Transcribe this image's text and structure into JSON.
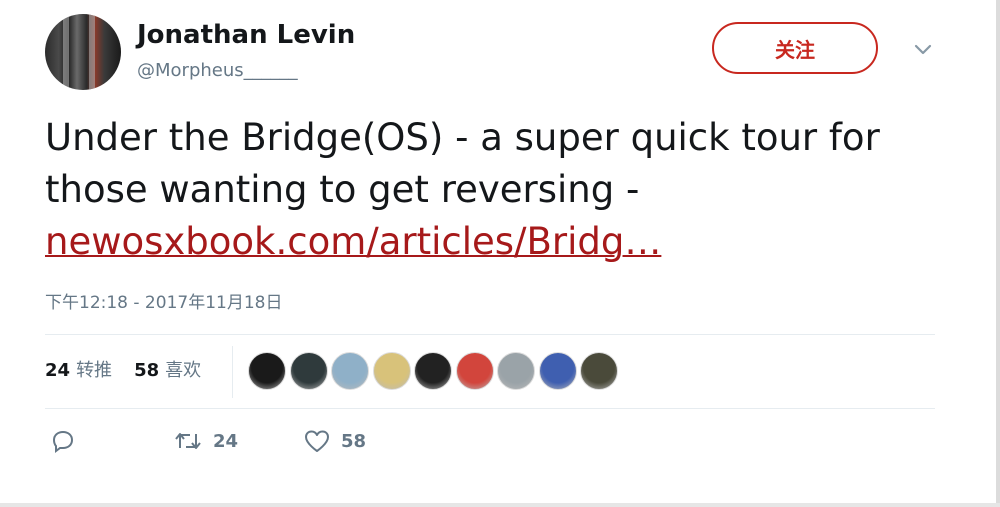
{
  "author": {
    "name": "Jonathan Levin",
    "handle": "@Morpheus______"
  },
  "follow_button": {
    "label": "关注"
  },
  "tweet": {
    "text_line": "Under the Bridge(OS) - a super quick tour for those wanting to get reversing - ",
    "link_text": "newosxbook.com/articles/Bridg…",
    "timestamp": "下午12:18 - 2017年11月18日"
  },
  "stats": {
    "retweets_count": "24",
    "retweets_label": "转推",
    "likes_count": "58",
    "likes_label": "喜欢"
  },
  "likers": [
    {
      "name": "liker-avatar-1",
      "color": "#1a1a1a"
    },
    {
      "name": "liker-avatar-2",
      "color": "#2f3a3c"
    },
    {
      "name": "liker-avatar-3",
      "color": "#8fb0c8"
    },
    {
      "name": "liker-avatar-4",
      "color": "#d8c27a"
    },
    {
      "name": "liker-avatar-5",
      "color": "#222222"
    },
    {
      "name": "liker-avatar-6",
      "color": "#d2453c"
    },
    {
      "name": "liker-avatar-7",
      "color": "#9aa3a8"
    },
    {
      "name": "liker-avatar-8",
      "color": "#3f5fb0"
    },
    {
      "name": "liker-avatar-9",
      "color": "#4a4a3a"
    }
  ],
  "actions": {
    "reply_icon": "reply-icon",
    "retweet_icon": "retweet-icon",
    "retweet_count": "24",
    "like_icon": "heart-icon",
    "like_count": "58"
  },
  "colors": {
    "accent": "#c8281f",
    "link": "#a6191a",
    "muted": "#657786",
    "text": "#14171a"
  }
}
